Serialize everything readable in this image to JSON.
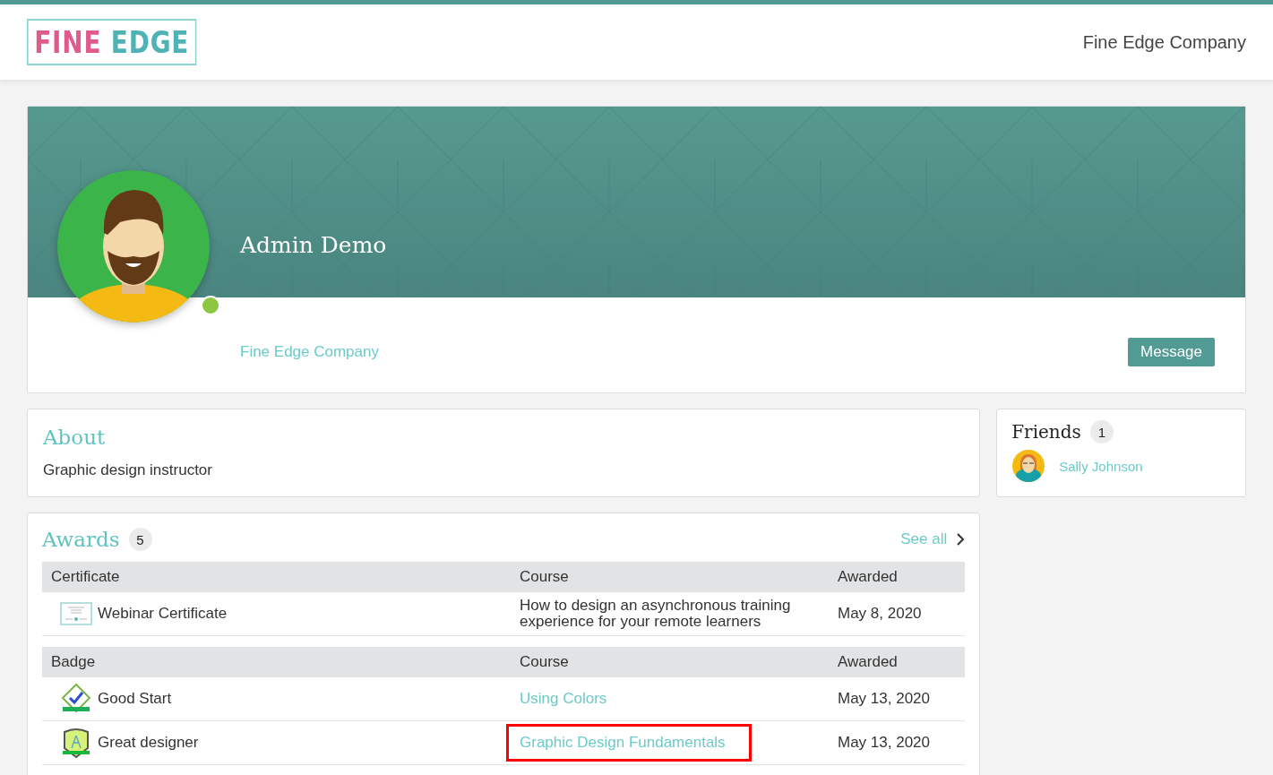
{
  "header": {
    "logo": {
      "first": "FINE",
      "second": "EDGE"
    },
    "company": "Fine Edge Company"
  },
  "profile": {
    "name": "Admin Demo",
    "company": "Fine Edge Company",
    "online": true,
    "message_button": "Message"
  },
  "about": {
    "title": "About",
    "text": "Graphic design instructor"
  },
  "friends": {
    "title": "Friends",
    "count": "1",
    "items": [
      {
        "name": "Sally Johnson"
      }
    ]
  },
  "awards": {
    "title": "Awards",
    "count": "5",
    "see_all": "See all",
    "sections": [
      {
        "kind": "certificate",
        "columns": [
          "Certificate",
          "Course",
          "Awarded"
        ],
        "rows": [
          {
            "name": "Webinar Certificate",
            "course": "How to design an asynchronous training experience for your remote learners",
            "course_link": false,
            "awarded": "May 8, 2020",
            "highlighted": false
          }
        ]
      },
      {
        "kind": "badge",
        "columns": [
          "Badge",
          "Course",
          "Awarded"
        ],
        "rows": [
          {
            "name": "Good Start",
            "kind": "check_badge",
            "course": "Using Colors",
            "course_link": true,
            "awarded": "May 13, 2020",
            "highlighted": false
          },
          {
            "name": "Great designer",
            "kind": "shield_badge",
            "course": "Graphic Design Fundamentals",
            "course_link": true,
            "awarded": "May 13, 2020",
            "highlighted": true
          }
        ]
      }
    ]
  }
}
